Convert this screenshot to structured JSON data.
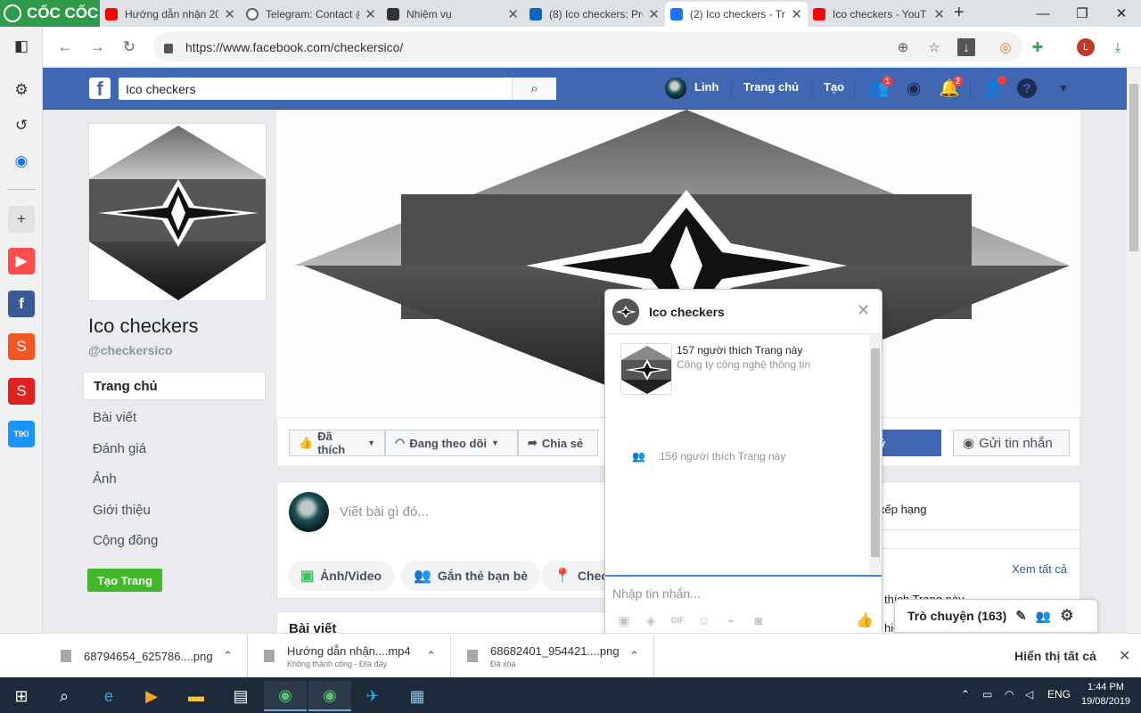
{
  "browser": {
    "brand": "CỐC CỐC",
    "tabs": [
      {
        "title": "Hướng dẫn nhận 20",
        "icon": "youtube-icon",
        "color": "#ff0000"
      },
      {
        "title": "Telegram: Contact @",
        "icon": "globe-icon",
        "color": "#5f6368"
      },
      {
        "title": "Nhiệm vụ",
        "icon": "ico-checkers-icon",
        "color": "#333333"
      },
      {
        "title": "(8) Ico checkers: Pro",
        "icon": "linkedin-icon",
        "color": "#0a66c2"
      },
      {
        "title": "(2) Ico checkers - Tr",
        "icon": "facebook-icon",
        "color": "#1877f2",
        "active": true
      },
      {
        "title": "Ico checkers - YouT",
        "icon": "youtube-icon",
        "color": "#ff0000"
      }
    ],
    "new_tab": "+",
    "url": "https://www.facebook.com/checkersico/"
  },
  "facebook": {
    "search_value": "Ico checkers",
    "user_name": "Linh",
    "nav_home": "Trang chủ",
    "nav_create": "Tạo",
    "badges": {
      "friends": "1",
      "notifications": "2"
    },
    "page": {
      "name": "Ico checkers",
      "handle": "@checkersico",
      "nav": [
        "Trang chủ",
        "Bài viết",
        "Đánh giá",
        "Ảnh",
        "Giới thiệu",
        "Cộng đồng"
      ],
      "create_page": "Tạo Trang"
    },
    "actions": {
      "liked": "Đã thích",
      "following": "Đang theo dõi",
      "share": "Chia sẻ",
      "hidden_label": "ý",
      "send_message": "Gửi tin nhắn"
    },
    "composer": {
      "placeholder": "Viết bài gì đó...",
      "chips": [
        "Ảnh/Video",
        "Gắn thẻ bạn bè",
        "Chec"
      ]
    },
    "posts_header": "Bài viết",
    "sidebar_right": {
      "rating_text": "xếp hạng",
      "see_all": "Xem tất cả",
      "likes_partial": "thích Trang này",
      "partial_bottom": "hic"
    },
    "chat_dock": {
      "label": "Trò chuyện (163)"
    }
  },
  "chat_window": {
    "title": "Ico checkers",
    "likes_line": "157 người thích Trang này",
    "category": "Công ty công nghệ thông tin",
    "likes_line_2": "156 người thích Trang này",
    "input_placeholder": "Nhập tin nhắn..."
  },
  "downloads": {
    "items": [
      {
        "name": "68794654_625786....png",
        "status": ""
      },
      {
        "name": "Hướng dẫn nhận....mp4",
        "status": "Không thành công - Đĩa đầy"
      },
      {
        "name": "68682401_954421....png",
        "status": "Đã xóa"
      }
    ],
    "show_all": "Hiển thị tất cả"
  },
  "taskbar": {
    "lang": "ENG",
    "time": "1:44 PM",
    "date": "19/08/2019"
  },
  "colors": {
    "fb_blue": "#4267b2",
    "coccoc_green": "#2e9b4a",
    "like_green": "#42b72a"
  }
}
